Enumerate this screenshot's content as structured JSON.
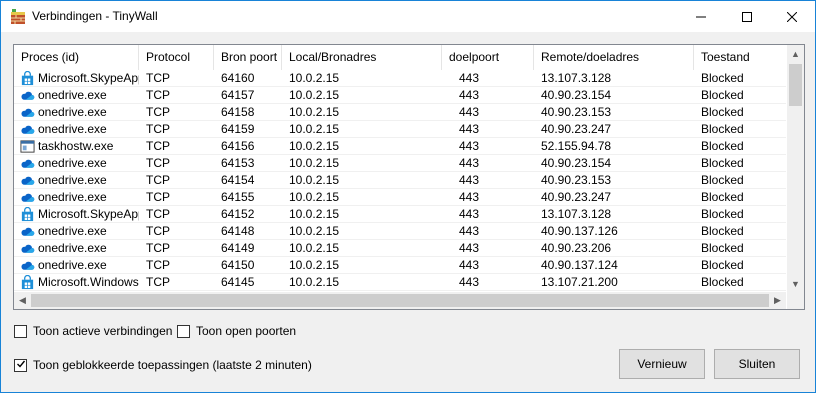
{
  "window": {
    "title": "Verbindingen - TinyWall"
  },
  "columns": [
    "Proces (id)",
    "Protocol",
    "Bron poort",
    "Local/Bronadres",
    "doelpoort",
    "Remote/doeladres",
    "Toestand"
  ],
  "rows": [
    {
      "icon": "store-app-icon",
      "process": "Microsoft.SkypeApp",
      "protocol": "TCP",
      "src_port": "64160",
      "local": "10.0.2.15",
      "dst_port": "443",
      "remote": "13.107.3.128",
      "state": "Blocked"
    },
    {
      "icon": "onedrive-cloud-icon",
      "process": "onedrive.exe",
      "protocol": "TCP",
      "src_port": "64157",
      "local": "10.0.2.15",
      "dst_port": "443",
      "remote": "40.90.23.154",
      "state": "Blocked"
    },
    {
      "icon": "onedrive-cloud-icon",
      "process": "onedrive.exe",
      "protocol": "TCP",
      "src_port": "64158",
      "local": "10.0.2.15",
      "dst_port": "443",
      "remote": "40.90.23.153",
      "state": "Blocked"
    },
    {
      "icon": "onedrive-cloud-icon",
      "process": "onedrive.exe",
      "protocol": "TCP",
      "src_port": "64159",
      "local": "10.0.2.15",
      "dst_port": "443",
      "remote": "40.90.23.247",
      "state": "Blocked"
    },
    {
      "icon": "taskhost-window-icon",
      "process": "taskhostw.exe",
      "protocol": "TCP",
      "src_port": "64156",
      "local": "10.0.2.15",
      "dst_port": "443",
      "remote": "52.155.94.78",
      "state": "Blocked"
    },
    {
      "icon": "onedrive-cloud-icon",
      "process": "onedrive.exe",
      "protocol": "TCP",
      "src_port": "64153",
      "local": "10.0.2.15",
      "dst_port": "443",
      "remote": "40.90.23.154",
      "state": "Blocked"
    },
    {
      "icon": "onedrive-cloud-icon",
      "process": "onedrive.exe",
      "protocol": "TCP",
      "src_port": "64154",
      "local": "10.0.2.15",
      "dst_port": "443",
      "remote": "40.90.23.153",
      "state": "Blocked"
    },
    {
      "icon": "onedrive-cloud-icon",
      "process": "onedrive.exe",
      "protocol": "TCP",
      "src_port": "64155",
      "local": "10.0.2.15",
      "dst_port": "443",
      "remote": "40.90.23.247",
      "state": "Blocked"
    },
    {
      "icon": "store-app-icon",
      "process": "Microsoft.SkypeApp",
      "protocol": "TCP",
      "src_port": "64152",
      "local": "10.0.2.15",
      "dst_port": "443",
      "remote": "13.107.3.128",
      "state": "Blocked"
    },
    {
      "icon": "onedrive-cloud-icon",
      "process": "onedrive.exe",
      "protocol": "TCP",
      "src_port": "64148",
      "local": "10.0.2.15",
      "dst_port": "443",
      "remote": "40.90.137.126",
      "state": "Blocked"
    },
    {
      "icon": "onedrive-cloud-icon",
      "process": "onedrive.exe",
      "protocol": "TCP",
      "src_port": "64149",
      "local": "10.0.2.15",
      "dst_port": "443",
      "remote": "40.90.23.206",
      "state": "Blocked"
    },
    {
      "icon": "onedrive-cloud-icon",
      "process": "onedrive.exe",
      "protocol": "TCP",
      "src_port": "64150",
      "local": "10.0.2.15",
      "dst_port": "443",
      "remote": "40.90.137.124",
      "state": "Blocked"
    },
    {
      "icon": "store-app-icon",
      "process": "Microsoft.Windows....",
      "protocol": "TCP",
      "src_port": "64145",
      "local": "10.0.2.15",
      "dst_port": "443",
      "remote": "13.107.21.200",
      "state": "Blocked"
    }
  ],
  "options": {
    "active_label": "Toon actieve verbindingen",
    "active_checked": false,
    "open_ports_label": "Toon open poorten",
    "open_ports_checked": false,
    "blocked_label": "Toon geblokkeerde toepassingen (laatste 2 minuten)",
    "blocked_checked": true
  },
  "buttons": {
    "refresh": "Vernieuw",
    "close": "Sluiten"
  },
  "colors": {
    "accent": "#1883d7",
    "onedrive": "#0a64c8",
    "store": "#1e8fd8"
  }
}
